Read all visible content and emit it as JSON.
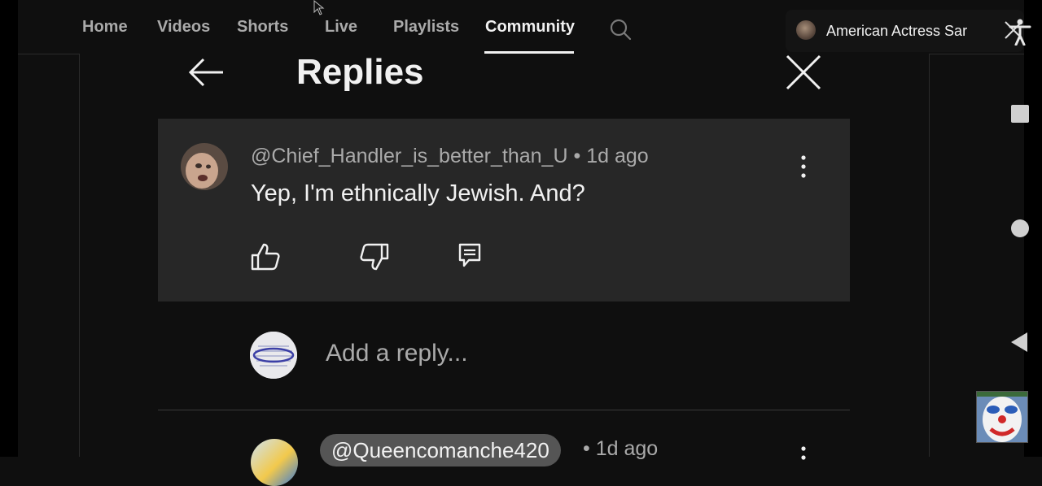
{
  "nav": {
    "tabs": [
      {
        "label": "Home"
      },
      {
        "label": "Videos"
      },
      {
        "label": "Shorts"
      },
      {
        "label": "Live"
      },
      {
        "label": "Playlists"
      },
      {
        "label": "Community",
        "active": true
      }
    ],
    "search_icon": "search-icon"
  },
  "ad": {
    "title": "American Actress Sar"
  },
  "replies_panel": {
    "title": "Replies",
    "back_icon": "arrow-left-icon",
    "close_icon": "close-icon"
  },
  "comment": {
    "author": "@Chief_Handler_is_better_than_U",
    "separator": "•",
    "time": "1d ago",
    "text": "Yep, I'm ethnically Jewish. And?",
    "actions": [
      "thumbs-up-icon",
      "thumbs-down-icon",
      "reply-icon"
    ]
  },
  "reply_box": {
    "placeholder": "Add a reply..."
  },
  "next_comment": {
    "author": "@Queencomanche420",
    "separator": "•",
    "time": "1d ago"
  },
  "system_nav": {
    "icons": [
      "recents-square-icon",
      "home-circle-icon",
      "back-triangle-icon"
    ]
  },
  "colors": {
    "background": "#0f0f0f",
    "card": "#272727",
    "text_primary": "#f1f1f1",
    "text_secondary": "#aaaaaa"
  }
}
